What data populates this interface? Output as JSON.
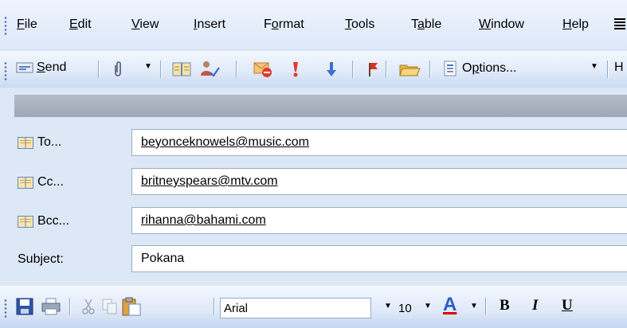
{
  "menubar": {
    "items": [
      {
        "label": "File",
        "underline": "F",
        "rest": "ile"
      },
      {
        "label": "Edit",
        "underline": "E",
        "rest": "dit"
      },
      {
        "label": "View",
        "underline": "V",
        "rest": "iew"
      },
      {
        "label": "Insert",
        "underline": "I",
        "rest": "nsert"
      },
      {
        "label": "Format",
        "pre": "F",
        "underline": "o",
        "rest": "rmat"
      },
      {
        "label": "Tools",
        "underline": "T",
        "rest": "ools"
      },
      {
        "label": "Table",
        "pre": "T",
        "underline": "a",
        "rest": "ble"
      },
      {
        "label": "Window",
        "underline": "W",
        "rest": "indow"
      },
      {
        "label": "Help",
        "underline": "H",
        "rest": "elp"
      }
    ]
  },
  "toolbar": {
    "send_label": "Send",
    "send_underline": "S",
    "send_rest": "end",
    "options_pre": "O",
    "options_underline": "p",
    "options_rest": "tions...",
    "overflow_text": "H",
    "icons": [
      "send-envelope-icon",
      "paperclip-icon",
      "address-book-icon",
      "check-names-icon",
      "permission-icon",
      "high-importance-icon",
      "low-importance-icon",
      "follow-up-flag-icon",
      "folder-icon",
      "options-icon"
    ]
  },
  "addresses": {
    "to": {
      "label": "To...",
      "value": "beyonceknowels@music.com"
    },
    "cc": {
      "label": "Cc...",
      "value": "britneyspears@mtv.com"
    },
    "bcc": {
      "label": "Bcc...",
      "value": "rihanna@bahami.com"
    },
    "subject": {
      "label": "Subject:",
      "value": "Pokana"
    }
  },
  "formatting": {
    "font": "Arial",
    "size": "10",
    "bold": "B",
    "italic": "I",
    "underline": "U",
    "font_color_letter": "A",
    "font_color": "#e00000",
    "icons": [
      "save-icon",
      "print-icon",
      "cut-icon",
      "copy-icon",
      "paste-icon",
      "font-color-icon"
    ]
  },
  "colors": {
    "accent": "#4b72b6",
    "band": "#a7b0bd",
    "background": "#dde8f7"
  }
}
